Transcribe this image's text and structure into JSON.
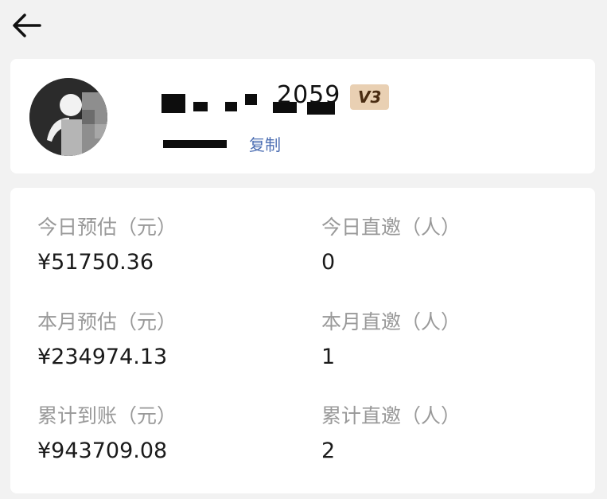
{
  "header": {
    "back_icon": "arrow-left-icon"
  },
  "profile": {
    "name_visible_tail": "2059",
    "level_badge": "V3",
    "copy_label": "复制",
    "avatar_icon": "user-avatar"
  },
  "stats": {
    "today_estimate_label": "今日预估（元）",
    "today_estimate_value": "¥51750.36",
    "today_invites_label": "今日直邀（人）",
    "today_invites_value": "0",
    "month_estimate_label": "本月预估（元）",
    "month_estimate_value": "¥234974.13",
    "month_invites_label": "本月直邀（人）",
    "month_invites_value": "1",
    "total_received_label": "累计到账（元）",
    "total_received_value": "¥943709.08",
    "total_invites_label": "累计直邀（人）",
    "total_invites_value": "2"
  },
  "colors": {
    "background": "#f2f2f2",
    "card": "#ffffff",
    "label": "#999999",
    "value": "#1a1a1a",
    "badge_bg": "#e9d0b3",
    "badge_text": "#4a2c12",
    "link": "#4d6fb3"
  }
}
